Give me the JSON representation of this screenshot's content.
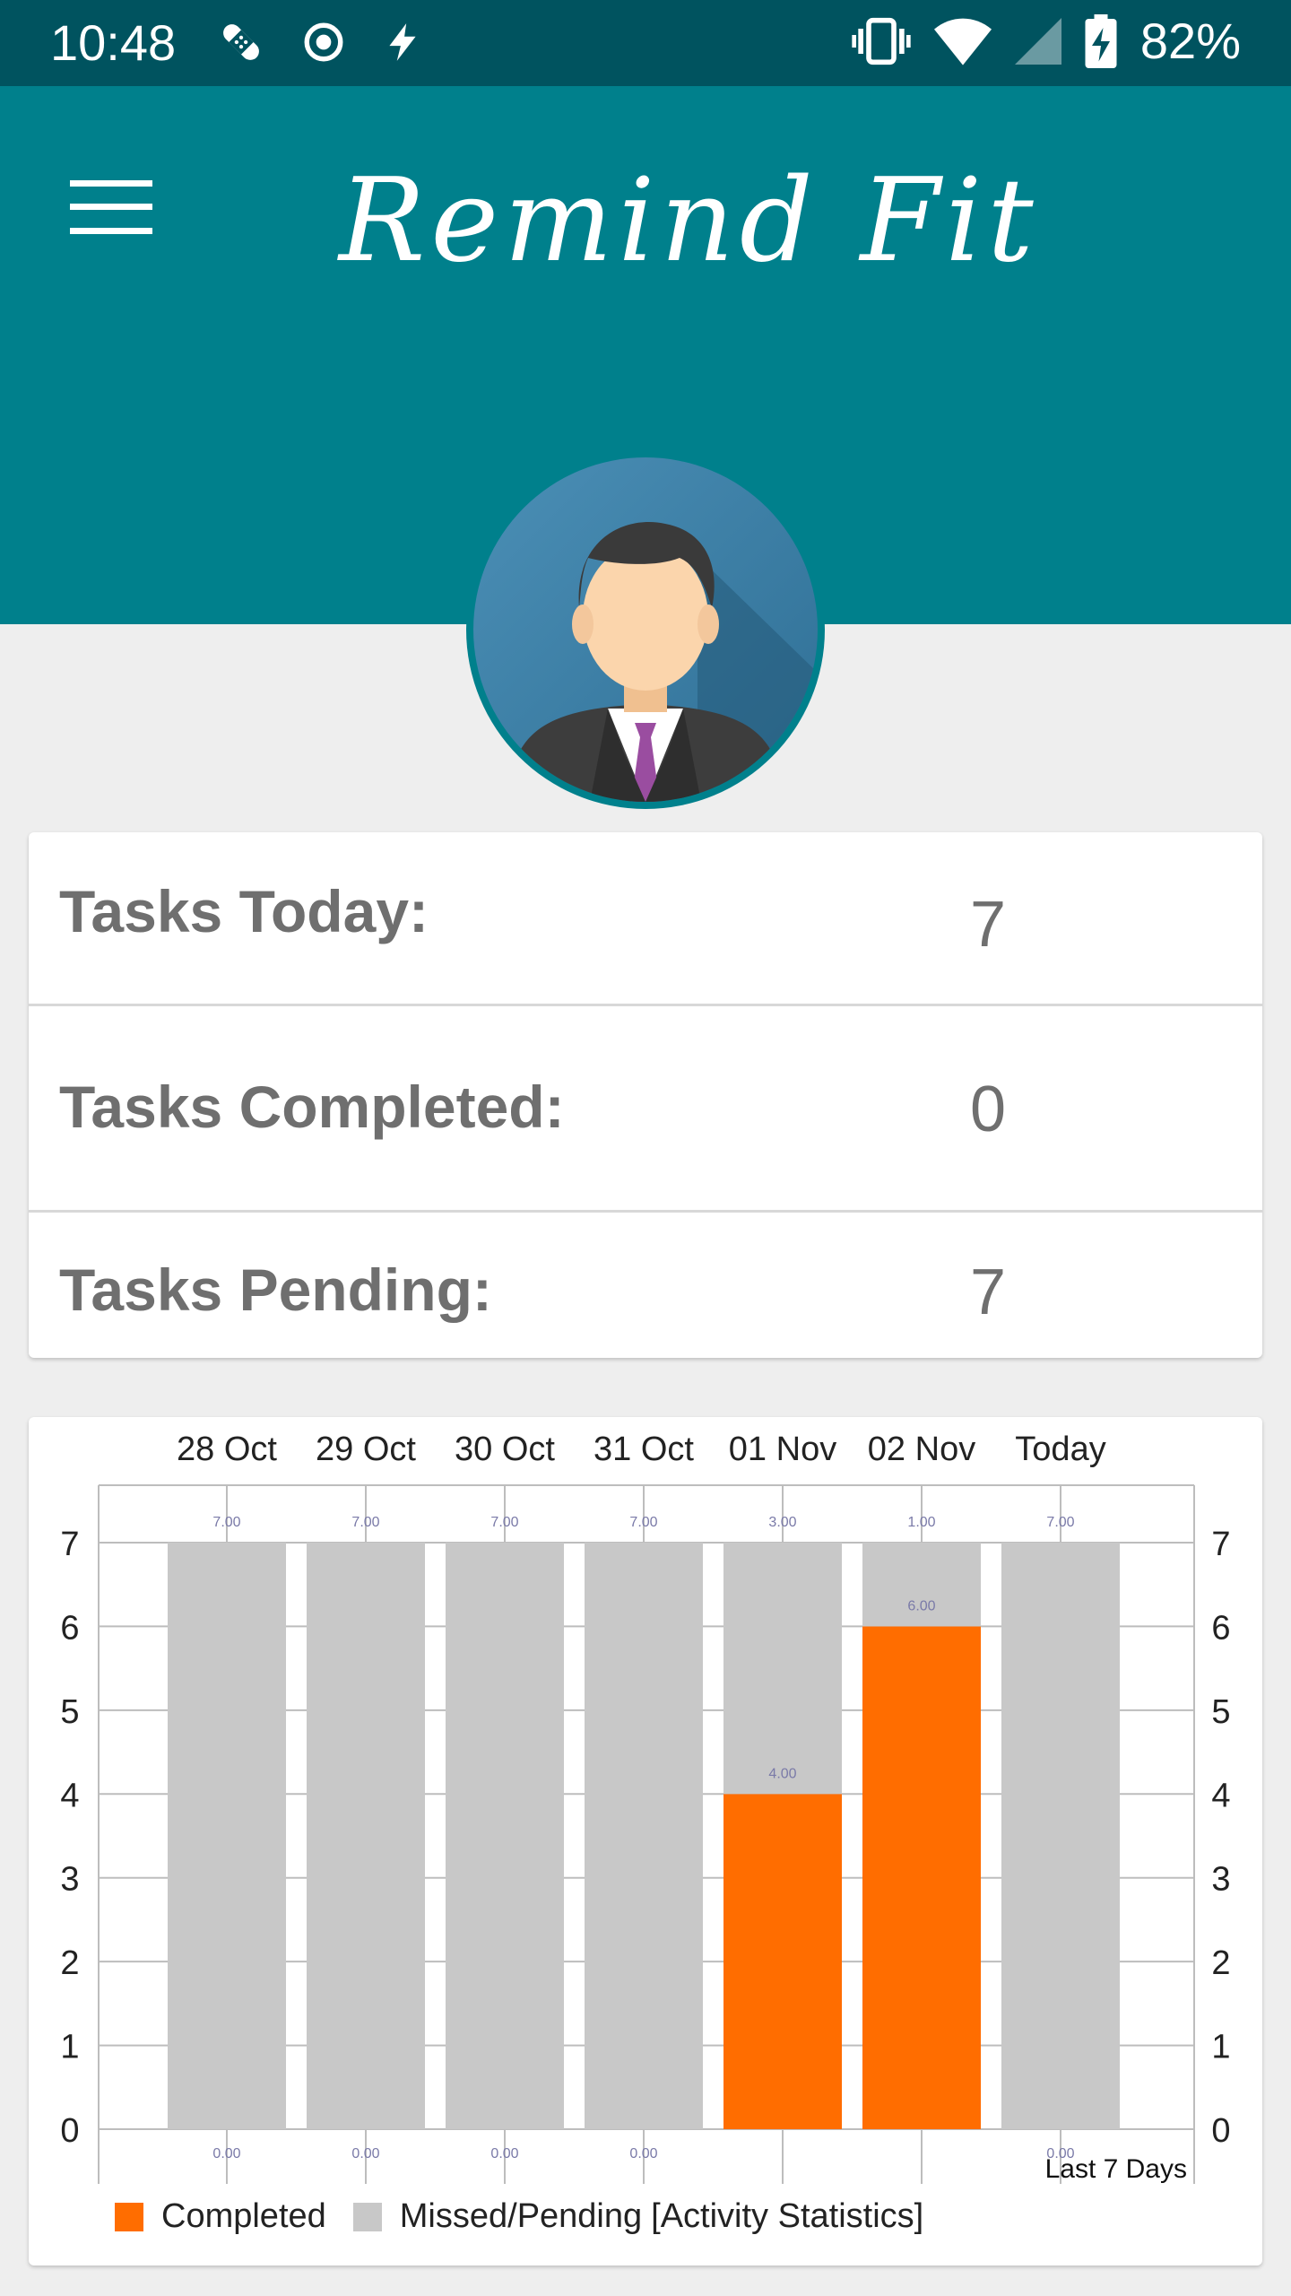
{
  "status_bar": {
    "time": "10:48",
    "battery": "82%",
    "icons": [
      "bandage-icon",
      "radio-button-icon",
      "flash-icon",
      "vibrate-icon",
      "wifi-icon",
      "cell-signal-icon",
      "battery-charging-icon"
    ]
  },
  "app_bar": {
    "title": "Remind Fit",
    "menu_icon": "hamburger-menu-icon",
    "colors": {
      "status_bar": "#00535f",
      "app_bar": "#00808c"
    }
  },
  "stats": {
    "today_label": "Tasks Today:",
    "today_value": "7",
    "completed_label": "Tasks Completed:",
    "completed_value": "0",
    "pending_label": "Tasks Pending:",
    "pending_value": "7"
  },
  "chart_data": {
    "type": "bar",
    "stacked": true,
    "categories": [
      "28 Oct",
      "29 Oct",
      "30 Oct",
      "31 Oct",
      "01 Nov",
      "02 Nov",
      "Today"
    ],
    "series": [
      {
        "name": "Completed",
        "values": [
          0,
          0,
          0,
          0,
          4,
          6,
          0
        ],
        "color": "#ff6d00"
      },
      {
        "name": "Missed/Pending",
        "values": [
          7,
          7,
          7,
          7,
          3,
          1,
          7
        ],
        "color": "#c8c8c8"
      }
    ],
    "ylim": [
      0,
      7
    ],
    "yticks": [
      0,
      1,
      2,
      3,
      4,
      5,
      6,
      7
    ],
    "axis_position": "top",
    "description": "Last 7 Days",
    "legend_suffix": "[Activity Statistics]",
    "grid": true
  }
}
